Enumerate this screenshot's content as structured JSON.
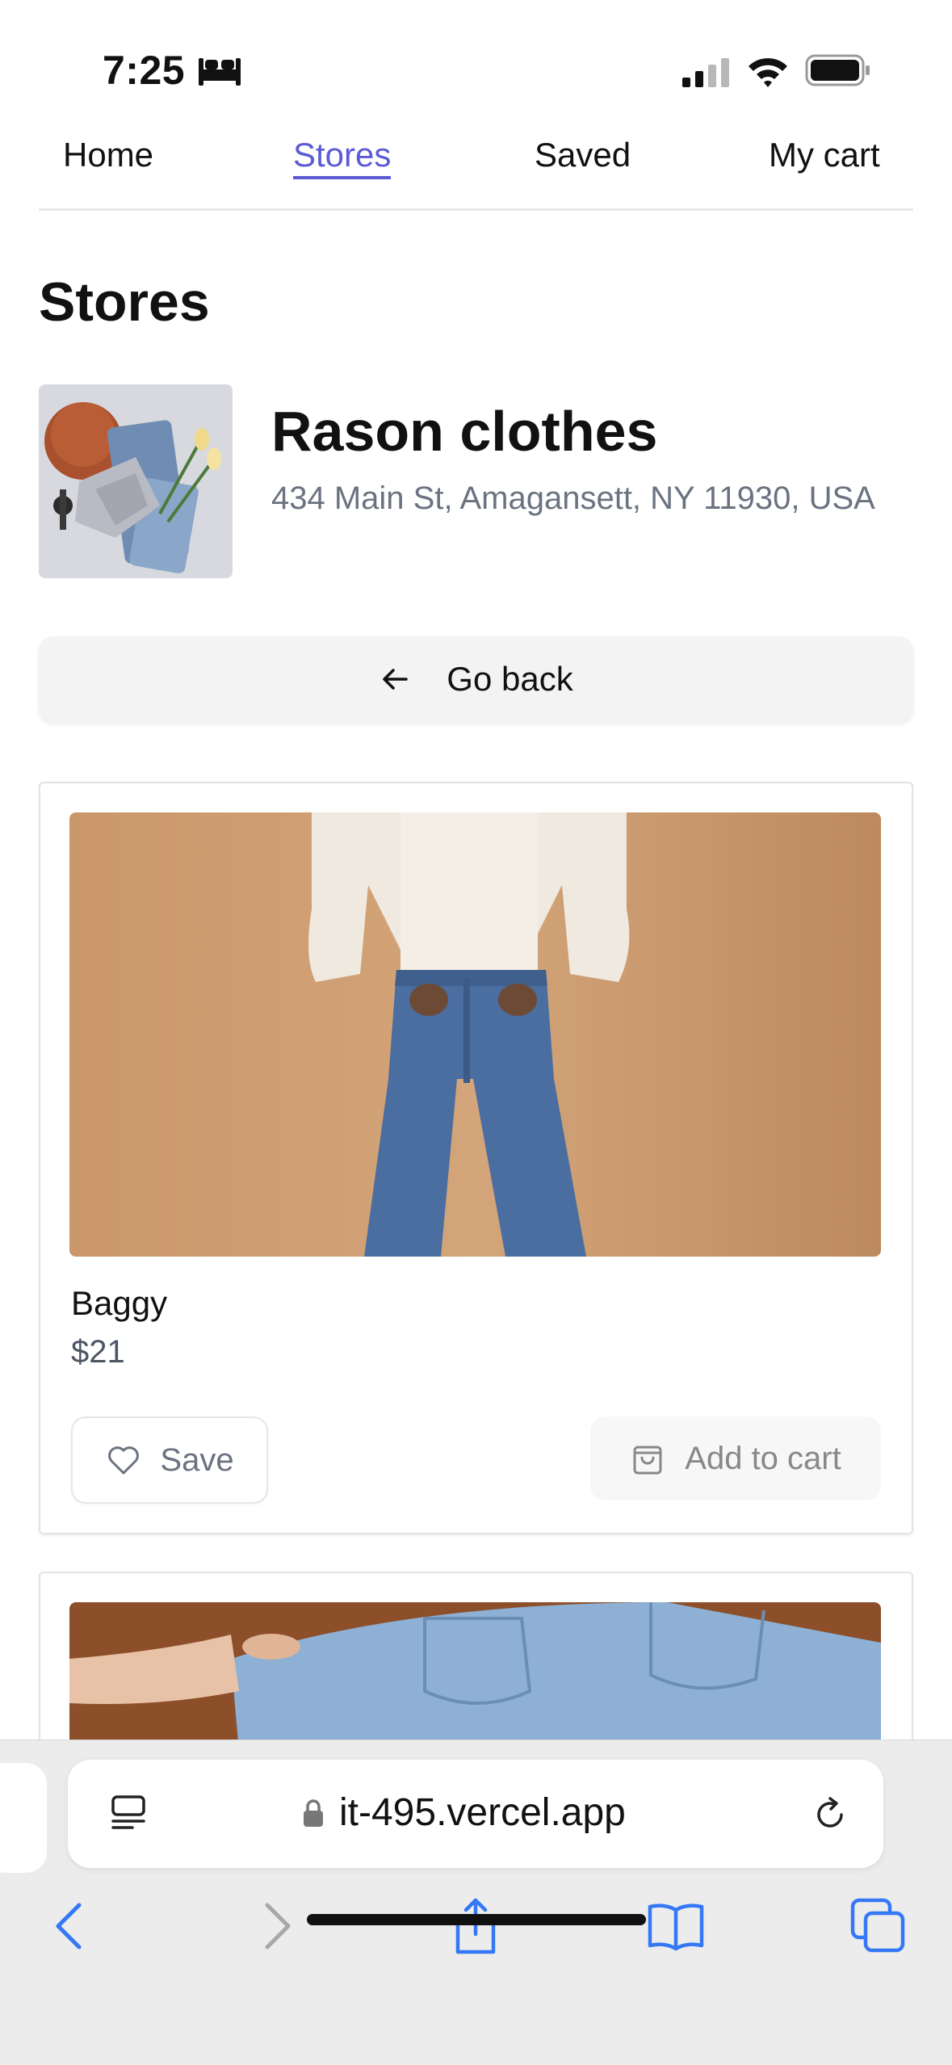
{
  "status_bar": {
    "time": "7:25"
  },
  "nav": {
    "tabs": [
      {
        "label": "Home",
        "active": false
      },
      {
        "label": "Stores",
        "active": true
      },
      {
        "label": "Saved",
        "active": false
      },
      {
        "label": "My cart",
        "active": false
      }
    ]
  },
  "page": {
    "title": "Stores"
  },
  "store": {
    "name": "Rason clothes",
    "address": "434 Main St, Amagansett, NY 11930, USA"
  },
  "actions": {
    "go_back_label": "Go back"
  },
  "products": [
    {
      "name": "Baggy",
      "price": "$21",
      "save_label": "Save",
      "cart_label": "Add to cart"
    }
  ],
  "browser": {
    "url": "it-495.vercel.app"
  },
  "colors": {
    "accent": "#5b5bd6",
    "safari_blue": "#3478f6",
    "muted_text": "#6b7280"
  },
  "icons": [
    "bed-icon",
    "signal-icon",
    "wifi-icon",
    "battery-icon",
    "arrow-left-icon",
    "heart-icon",
    "shopping-bag-icon",
    "reader-icon",
    "lock-icon",
    "reload-icon",
    "back-chevron-icon",
    "forward-chevron-icon",
    "share-icon",
    "bookmarks-icon",
    "tabs-icon"
  ]
}
